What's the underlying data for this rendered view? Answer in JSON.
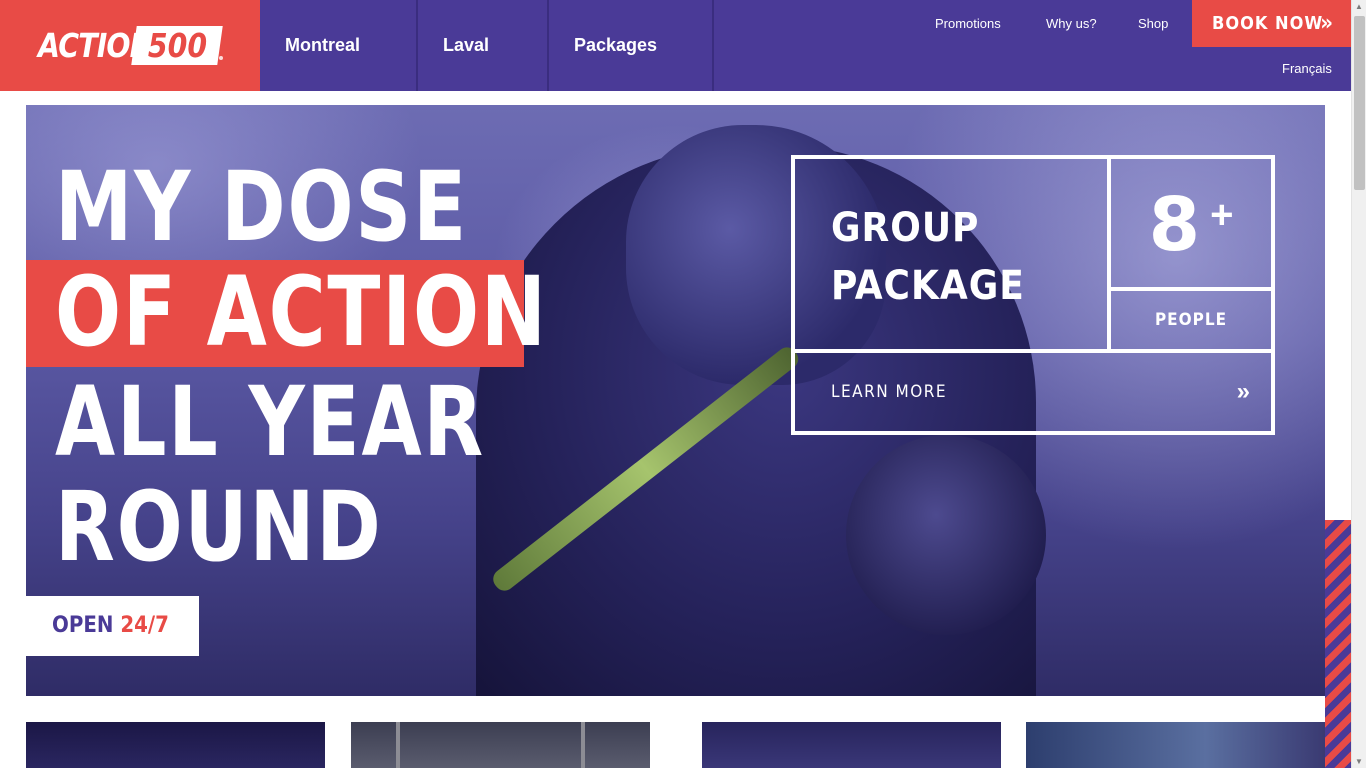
{
  "brand": {
    "word": "ACTION",
    "number": "500"
  },
  "nav": {
    "items": [
      {
        "label": "Montreal"
      },
      {
        "label": "Laval"
      },
      {
        "label": "Packages"
      }
    ]
  },
  "top_links": {
    "promotions": "Promotions",
    "why": "Why us?",
    "shop": "Shop",
    "book_now": "BOOK NOW",
    "book_now_icon": "»",
    "language": "Français"
  },
  "hero": {
    "headline": [
      "MY DOSE",
      "OF ACTION",
      "ALL YEAR",
      "ROUND"
    ],
    "open_label": "OPEN",
    "open_hours": "24/7"
  },
  "promo": {
    "title_line1": "GROUP",
    "title_line2": "PACKAGE",
    "count": "8",
    "count_suffix": "+",
    "unit": "PEOPLE",
    "cta": "LEARN MORE",
    "cta_icon": "»"
  },
  "icons": {
    "book_now": "double-chevron-right-icon",
    "cta": "double-chevron-right-icon",
    "scroll_up": "scroll-up-arrow-icon",
    "scroll_down": "scroll-down-arrow-icon"
  },
  "colors": {
    "brand_red": "#e84b46",
    "brand_purple": "#4a3a97",
    "white": "#ffffff"
  }
}
